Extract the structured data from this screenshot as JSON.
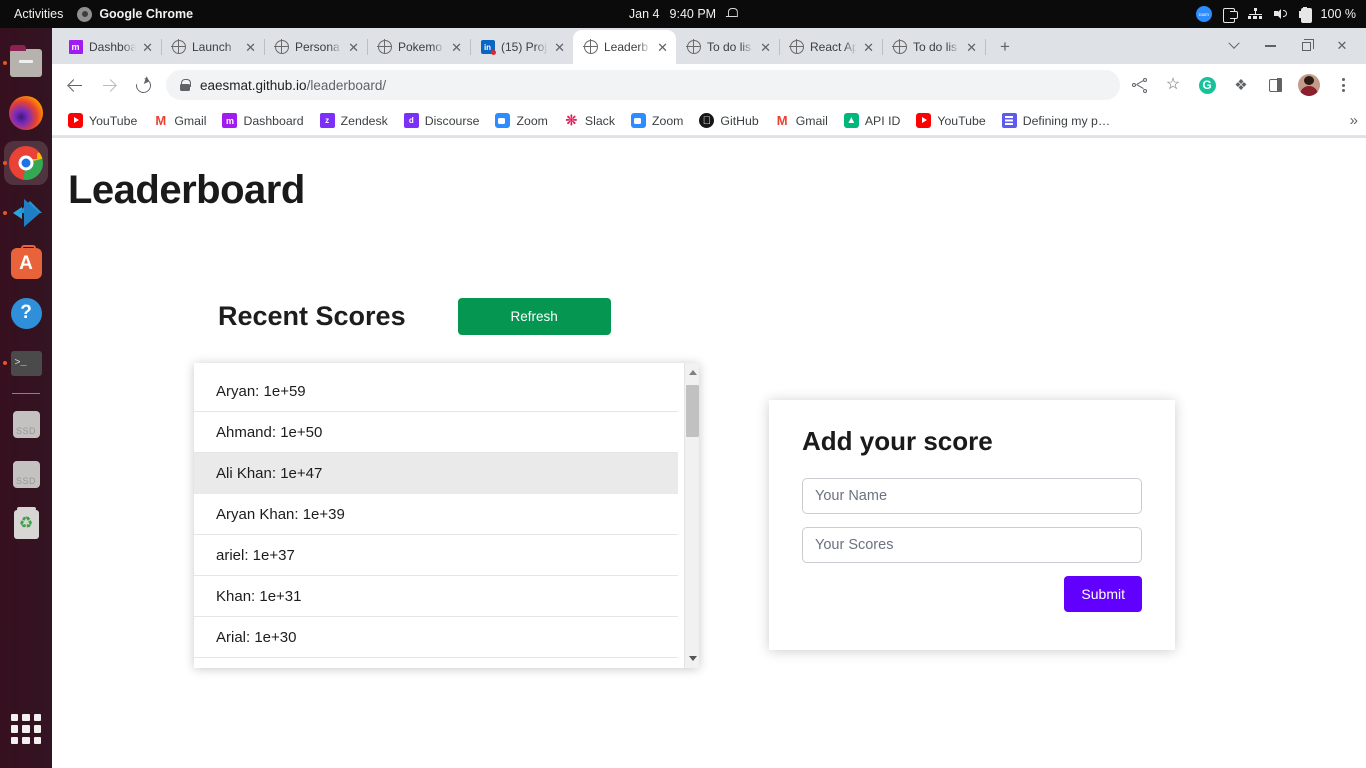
{
  "system_bar": {
    "activities": "Activities",
    "app_name": "Google Chrome",
    "date": "Jan 4",
    "time": "9:40 PM",
    "battery": "100 %",
    "icons": [
      "bell-icon",
      "zoom-indicator-icon",
      "screencast-icon",
      "network-icon",
      "volume-icon",
      "battery-icon"
    ]
  },
  "dock": {
    "items": [
      {
        "name": "files",
        "running": true,
        "active": false
      },
      {
        "name": "firefox",
        "running": false,
        "active": false
      },
      {
        "name": "google-chrome",
        "running": true,
        "active": true
      },
      {
        "name": "visual-studio-code",
        "running": true,
        "active": false
      },
      {
        "name": "ubuntu-software",
        "running": false,
        "active": false
      },
      {
        "name": "help",
        "running": false,
        "active": false
      },
      {
        "name": "terminal",
        "running": true,
        "active": false
      },
      {
        "name": "ssd-drive-1",
        "running": false,
        "active": false
      },
      {
        "name": "ssd-drive-2",
        "running": false,
        "active": false
      },
      {
        "name": "trash",
        "running": false,
        "active": false
      }
    ],
    "show_applications": "Show Applications"
  },
  "browser": {
    "tabs": [
      {
        "label": "Dashboa",
        "favicon": "monday-icon",
        "active": false
      },
      {
        "label": "Launch ",
        "favicon": "globe-icon",
        "active": false
      },
      {
        "label": "Persona",
        "favicon": "globe-icon",
        "active": false
      },
      {
        "label": "Pokemo",
        "favicon": "globe-icon",
        "active": false
      },
      {
        "label": "(15) Proj",
        "favicon": "linkedin-icon",
        "active": false
      },
      {
        "label": "Leaderb",
        "favicon": "globe-icon",
        "active": true
      },
      {
        "label": "To do lis",
        "favicon": "globe-icon",
        "active": false
      },
      {
        "label": "React Ap",
        "favicon": "globe-icon",
        "active": false
      },
      {
        "label": "To do lis",
        "favicon": "globe-icon",
        "active": false
      }
    ],
    "new_tab_label": "+",
    "tab_close_label": "✕",
    "window_controls": [
      "tab-search-chevron",
      "minimize",
      "maximize",
      "close"
    ],
    "url_domain": "eaesmat.github.io",
    "url_path": "/leaderboard/",
    "toolbar_icons": [
      "back-icon",
      "forward-icon",
      "reload-icon",
      "lock-icon",
      "share-icon",
      "bookmark-star-icon",
      "grammarly-icon",
      "extensions-puzzle-icon",
      "side-panel-icon",
      "profile-avatar",
      "chrome-menu-icon"
    ],
    "grammarly_letter": "G",
    "puzzle_glyph": "❖",
    "bookmarks": [
      {
        "label": "YouTube",
        "icon": "youtube-icon"
      },
      {
        "label": "Gmail",
        "icon": "gmail-icon"
      },
      {
        "label": "Dashboard",
        "icon": "monday-icon"
      },
      {
        "label": "Zendesk",
        "icon": "zendesk-icon"
      },
      {
        "label": "Discourse",
        "icon": "discourse-icon"
      },
      {
        "label": "Zoom",
        "icon": "zoom-icon"
      },
      {
        "label": "Slack",
        "icon": "slack-icon"
      },
      {
        "label": "Zoom",
        "icon": "zoom-icon"
      },
      {
        "label": "GitHub",
        "icon": "github-icon"
      },
      {
        "label": "Gmail",
        "icon": "gmail-icon"
      },
      {
        "label": "API ID",
        "icon": "apiid-icon"
      },
      {
        "label": "YouTube",
        "icon": "youtube-icon"
      },
      {
        "label": "Defining my p…",
        "icon": "document-icon"
      }
    ],
    "bookmarks_overflow": "»"
  },
  "page": {
    "title": "Leaderboard",
    "recent_scores_title": "Recent Scores",
    "refresh_label": "Refresh",
    "scores": [
      {
        "text": "Aryan: 1e+59",
        "highlight": false
      },
      {
        "text": "Ahmand: 1e+50",
        "highlight": false
      },
      {
        "text": "Ali Khan: 1e+47",
        "highlight": true
      },
      {
        "text": "Aryan Khan: 1e+39",
        "highlight": false
      },
      {
        "text": "ariel: 1e+37",
        "highlight": false
      },
      {
        "text": "Khan: 1e+31",
        "highlight": false
      },
      {
        "text": "Arial: 1e+30",
        "highlight": false
      }
    ],
    "add_card": {
      "title": "Add your score",
      "name_value": "",
      "name_placeholder": "Your Name",
      "score_value": "",
      "score_placeholder": "Your Scores",
      "submit_label": "Submit"
    }
  },
  "colors": {
    "refresh_green": "#059652",
    "submit_purple": "#6200ff",
    "dock_bg": "#36101f",
    "topbar_bg": "#0b0b0b"
  }
}
